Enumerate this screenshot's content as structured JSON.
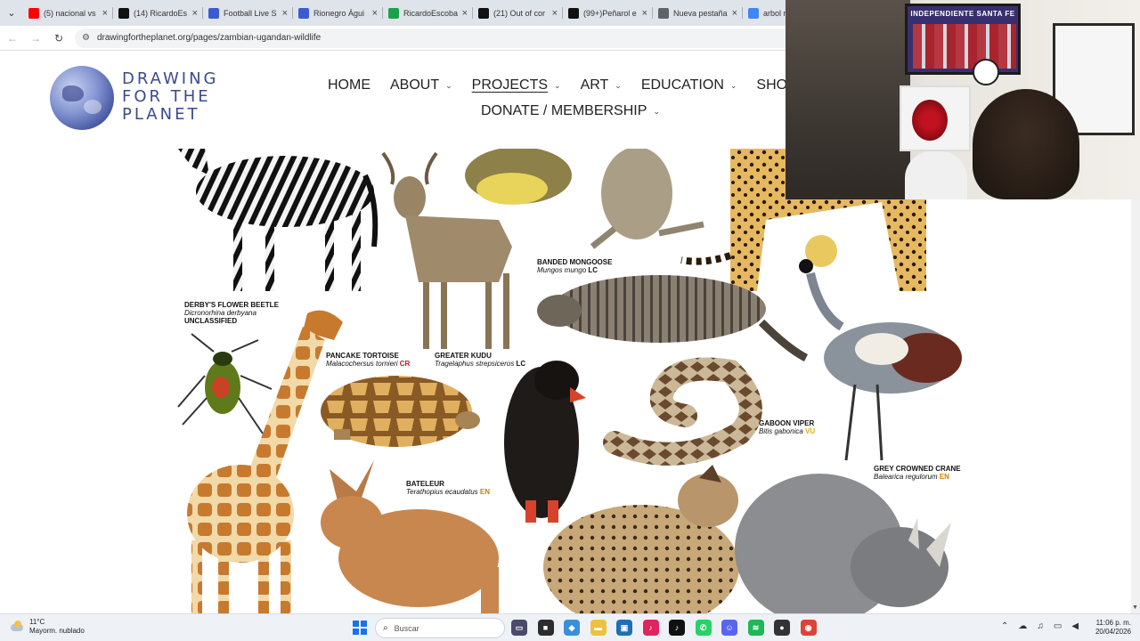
{
  "browser": {
    "tabs": [
      {
        "label": "(5) nacional vs",
        "icon": "youtube-icon",
        "color": "#ff0000"
      },
      {
        "label": "(14) RicardoEs",
        "icon": "x-icon",
        "color": "#111111"
      },
      {
        "label": "Football Live S",
        "icon": "site-icon",
        "color": "#3c5bd1"
      },
      {
        "label": "Rionegro Águi",
        "icon": "site-icon",
        "color": "#3c5bd1"
      },
      {
        "label": "RicardoEscoba",
        "icon": "k-icon",
        "color": "#18a34a"
      },
      {
        "label": "(21) Out of cor",
        "icon": "x-icon",
        "color": "#111111"
      },
      {
        "label": "(99+)Peñarol e",
        "icon": "tiktok-icon",
        "color": "#111111"
      },
      {
        "label": "Nueva pestaña",
        "icon": "chrome-icon",
        "color": "#5f6368"
      },
      {
        "label": "arbol na",
        "icon": "google-icon",
        "color": "#4285f4"
      }
    ],
    "url": "drawingfortheplanet.org/pages/zambian-ugandan-wildlife"
  },
  "site": {
    "logo_lines": [
      "DRAWING",
      "FOR THE",
      "PLANET"
    ],
    "nav_row1": [
      {
        "label": "HOME",
        "dropdown": false,
        "active": false
      },
      {
        "label": "ABOUT",
        "dropdown": true,
        "active": false
      },
      {
        "label": "PROJECTS",
        "dropdown": true,
        "active": true
      },
      {
        "label": "ART",
        "dropdown": true,
        "active": false
      },
      {
        "label": "EDUCATION",
        "dropdown": true,
        "active": false
      },
      {
        "label": "SHOP",
        "dropdown": false,
        "active": false
      }
    ],
    "nav_row2": [
      {
        "label": "DONATE / MEMBERSHIP",
        "dropdown": true,
        "active": false
      }
    ]
  },
  "animals": {
    "beetle": {
      "name": "DERBY'S FLOWER BEETLE",
      "sci": "Dicronorhina derbyana",
      "status": "UNCLASSIFIED"
    },
    "tortoise": {
      "name": "PANCAKE TORTOISE",
      "sci": "Malacochersus tornieri",
      "status": "CR"
    },
    "kudu": {
      "name": "GREATER KUDU",
      "sci": "Tragelaphus strepsiceros",
      "status": "LC"
    },
    "mongoose": {
      "name": "BANDED MONGOOSE",
      "sci": "Mungos mungo",
      "status": "LC"
    },
    "viper": {
      "name": "GABOON VIPER",
      "sci": "Bitis gabonica",
      "status": "VU"
    },
    "bateleur": {
      "name": "BATELEUR",
      "sci": "Terathopius ecaudatus",
      "status": "EN"
    },
    "crane": {
      "name": "GREY CROWNED CRANE",
      "sci": "Balearica regulorum",
      "status": "EN"
    }
  },
  "webcam": {
    "poster_text": "INDEPENDIENTE SANTA FE"
  },
  "taskbar": {
    "weather_temp": "11°C",
    "weather_desc": "Mayorm. nublado",
    "search_placeholder": "Buscar",
    "time": "11:06 p. m.",
    "date": "20/04/2026"
  }
}
